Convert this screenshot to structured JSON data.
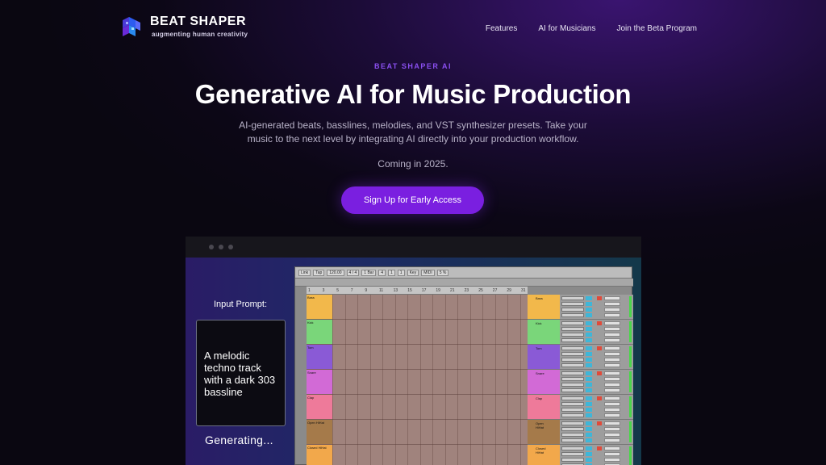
{
  "brand": {
    "name": "BEAT SHAPER",
    "tagline": "augmenting human creativity"
  },
  "nav": {
    "items": [
      "Features",
      "AI for Musicians",
      "Join the Beta Program"
    ]
  },
  "hero": {
    "eyebrow": "BEAT SHAPER AI",
    "headline": "Generative AI for Music Production",
    "subtext": "AI-generated beats, basslines, melodies, and VST synthesizer presets. Take your music to the next level by integrating AI directly into your production workflow.",
    "coming": "Coming in 2025.",
    "cta_label": "Sign Up for Early Access"
  },
  "demo": {
    "prompt_label": "Input Prompt:",
    "prompt_text": "A melodic techno track with a dark 303 bassline",
    "status": "Generating...",
    "tracks": [
      {
        "name": "Bass",
        "color": "#f2b84b"
      },
      {
        "name": "Kick",
        "color": "#7ad67a"
      },
      {
        "name": "Tom",
        "color": "#8a5ad6"
      },
      {
        "name": "Snare",
        "color": "#d26ad6"
      },
      {
        "name": "Clap",
        "color": "#ee7a9a"
      },
      {
        "name": "Open HiHat",
        "color": "#a57a4a"
      },
      {
        "name": "Closed HiHat",
        "color": "#f2a84b"
      }
    ],
    "ruler": [
      "1",
      "3",
      "5",
      "7",
      "9",
      "11",
      "13",
      "15",
      "17",
      "19",
      "21",
      "23",
      "25",
      "27",
      "29",
      "31"
    ],
    "toolbar": [
      "Link",
      "Tap",
      "120.00",
      "4 / 4",
      "1 Bar",
      "4",
      "1",
      "1",
      "Key",
      "MIDI",
      "5 %"
    ]
  },
  "colors": {
    "accent": "#7a1fe0",
    "eyebrow": "#8a4ff0",
    "page_bg": "#0c0716"
  }
}
